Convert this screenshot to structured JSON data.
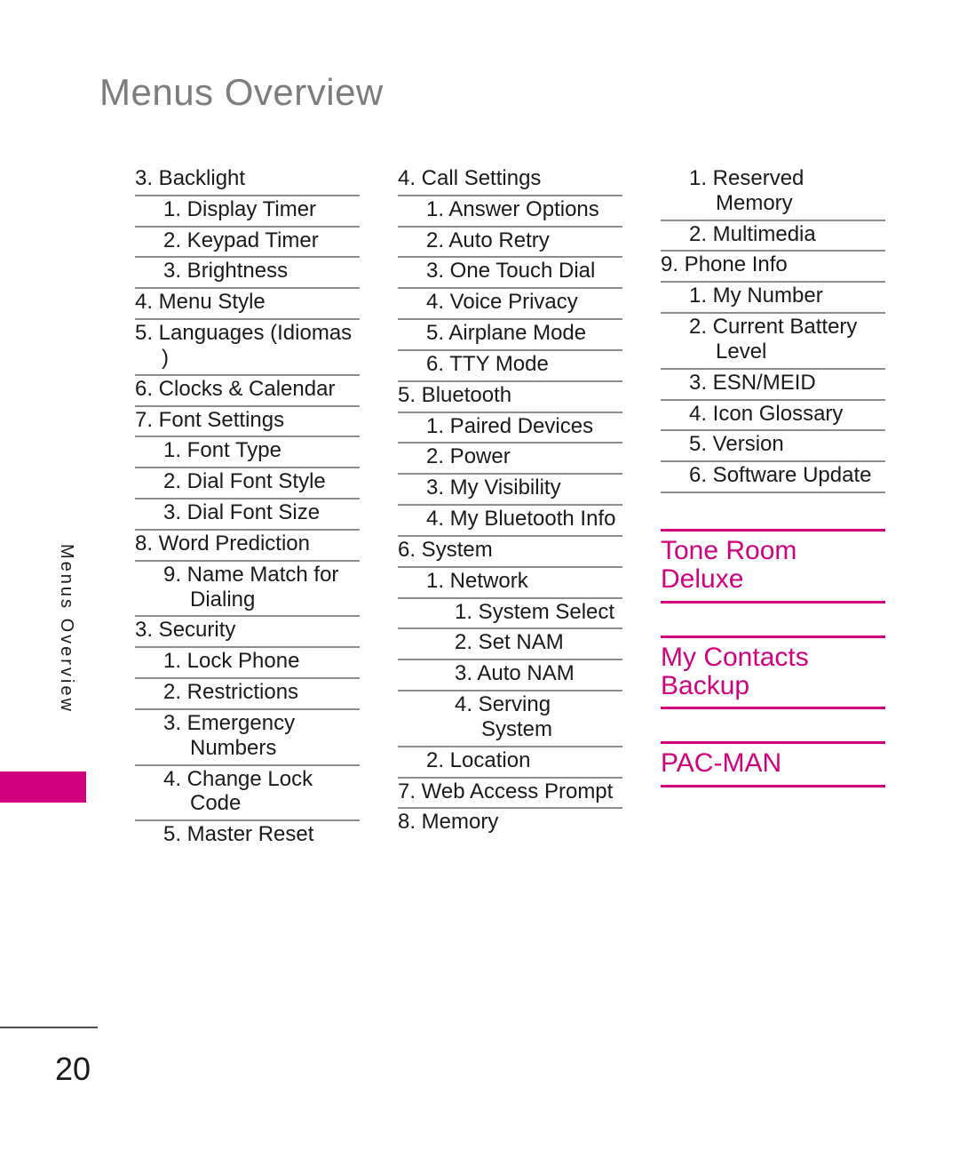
{
  "page": {
    "title": "Menus Overview",
    "side_label": "Menus Overview",
    "page_number": "20",
    "accent_color": "#d1007f",
    "title_color": "#7d7d7d",
    "text_color": "#1a1a1a",
    "rule_color": "#8c8c8c"
  },
  "columns": [
    {
      "name": "column-1",
      "items": [
        {
          "level": 1,
          "text": "3. Backlight"
        },
        {
          "level": 2,
          "text": "1. Display Timer"
        },
        {
          "level": 2,
          "text": "2. Keypad Timer"
        },
        {
          "level": 2,
          "text": "3. Brightness"
        },
        {
          "level": 1,
          "text": "4. Menu Style"
        },
        {
          "level": 1,
          "text": "5. Languages (Idiomas )"
        },
        {
          "level": 1,
          "text": "6. Clocks & Calendar"
        },
        {
          "level": 1,
          "text": "7. Font Settings"
        },
        {
          "level": 2,
          "text": "1. Font Type"
        },
        {
          "level": 2,
          "text": "2. Dial Font Style"
        },
        {
          "level": 2,
          "text": "3. Dial Font Size"
        },
        {
          "level": 1,
          "text": "8. Word Prediction"
        },
        {
          "level": 2,
          "text": "9. Name Match for Dialing"
        },
        {
          "level": 1,
          "text": "3. Security"
        },
        {
          "level": 2,
          "text": "1. Lock Phone"
        },
        {
          "level": 2,
          "text": "2. Restrictions"
        },
        {
          "level": 2,
          "text": "3. Emergency Numbers"
        },
        {
          "level": 2,
          "text": "4. Change Lock Code"
        },
        {
          "level": 2,
          "text": "5. Master Reset",
          "no_rule": true
        }
      ]
    },
    {
      "name": "column-2",
      "items": [
        {
          "level": 1,
          "text": "4. Call Settings"
        },
        {
          "level": 2,
          "text": "1. Answer Options"
        },
        {
          "level": 2,
          "text": "2. Auto Retry"
        },
        {
          "level": 2,
          "text": "3. One Touch Dial"
        },
        {
          "level": 2,
          "text": "4. Voice Privacy"
        },
        {
          "level": 2,
          "text": "5. Airplane Mode"
        },
        {
          "level": 2,
          "text": "6. TTY Mode"
        },
        {
          "level": 1,
          "text": "5. Bluetooth"
        },
        {
          "level": 2,
          "text": "1. Paired Devices"
        },
        {
          "level": 2,
          "text": "2. Power"
        },
        {
          "level": 2,
          "text": "3. My Visibility"
        },
        {
          "level": 2,
          "text": "4. My Bluetooth Info"
        },
        {
          "level": 1,
          "text": "6. System"
        },
        {
          "level": 2,
          "text": "1. Network"
        },
        {
          "level": 3,
          "text": "1. System Select"
        },
        {
          "level": 3,
          "text": "2. Set NAM"
        },
        {
          "level": 3,
          "text": "3. Auto NAM"
        },
        {
          "level": 3,
          "text": "4. Serving System"
        },
        {
          "level": 2,
          "text": "2. Location"
        },
        {
          "level": 1,
          "text": "7. Web Access Prompt"
        },
        {
          "level": 1,
          "text": "8. Memory",
          "no_rule": true
        }
      ]
    },
    {
      "name": "column-3",
      "items": [
        {
          "level": 2,
          "text": "1. Reserved Memory"
        },
        {
          "level": 2,
          "text": "2. Multimedia"
        },
        {
          "level": 1,
          "text": "9. Phone Info"
        },
        {
          "level": 2,
          "text": "1. My Number"
        },
        {
          "level": 2,
          "text": "2. Current Battery Level"
        },
        {
          "level": 2,
          "text": "3. ESN/MEID"
        },
        {
          "level": 2,
          "text": "4. Icon Glossary"
        },
        {
          "level": 2,
          "text": "5. Version"
        },
        {
          "level": 2,
          "text": "6. Software Update"
        }
      ],
      "features": [
        {
          "text": "Tone Room Deluxe"
        },
        {
          "text": "My Contacts Backup"
        },
        {
          "text": "PAC-MAN"
        }
      ]
    }
  ]
}
